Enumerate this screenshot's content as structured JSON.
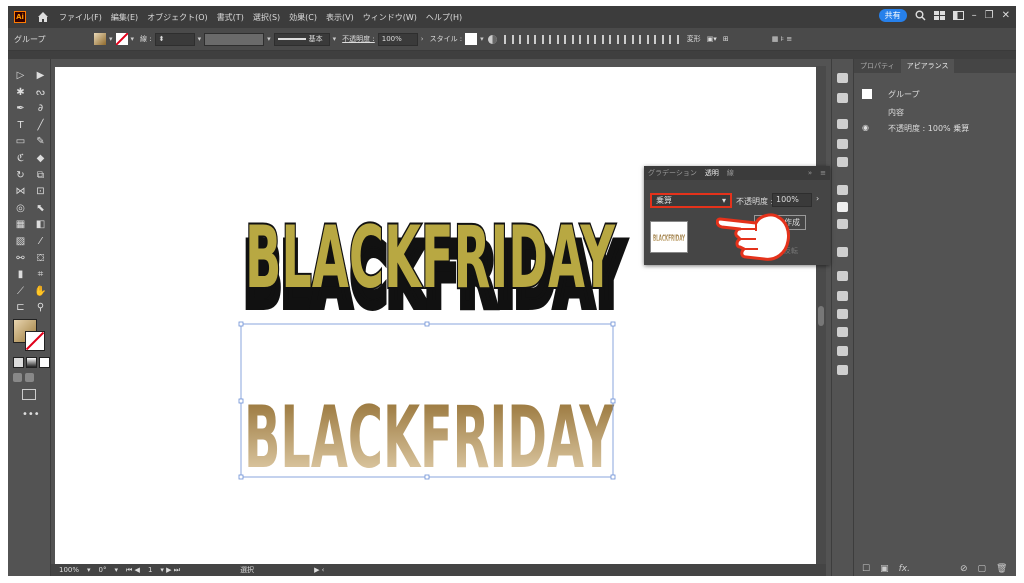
{
  "app": {
    "logo": "Ai"
  },
  "menu": [
    "ファイル(F)",
    "編集(E)",
    "オブジェクト(O)",
    "書式(T)",
    "選択(S)",
    "効果(C)",
    "表示(V)",
    "ウィンドウ(W)",
    "ヘルプ(H)"
  ],
  "topright": {
    "share": "共有"
  },
  "control": {
    "selection": "グループ",
    "stroke_label": "線 :",
    "stroke_style": "基本",
    "opacity_label": "不透明度 :",
    "opacity_value": "100%",
    "style_label": "スタイル :",
    "transform_label": "変形"
  },
  "canvas": {
    "top_text": "BLACKFRIDAY",
    "bottom_text": "BLACKFRIDAY",
    "top_color": "#b8a842",
    "gradient_light": "#ead9b8",
    "gradient_dark": "#8f6a2c"
  },
  "status": {
    "zoom": "100%",
    "rotation": "0°",
    "artboard": "1",
    "tool": "選択"
  },
  "right_panel": {
    "tab1": "プロパティ",
    "tab2": "アピアランス",
    "object": "グループ",
    "contents": "内容",
    "opacity_row": "不透明度 : 100% 乗算"
  },
  "transparency_panel": {
    "tab_gradient": "グラデーション",
    "tab_transparency": "透明",
    "tab_stroke": "線",
    "blend_mode": "乗算",
    "opacity_label": "不透明度 :",
    "opacity_value": "100%",
    "make_mask": "マスク作成",
    "invert": "反転"
  }
}
